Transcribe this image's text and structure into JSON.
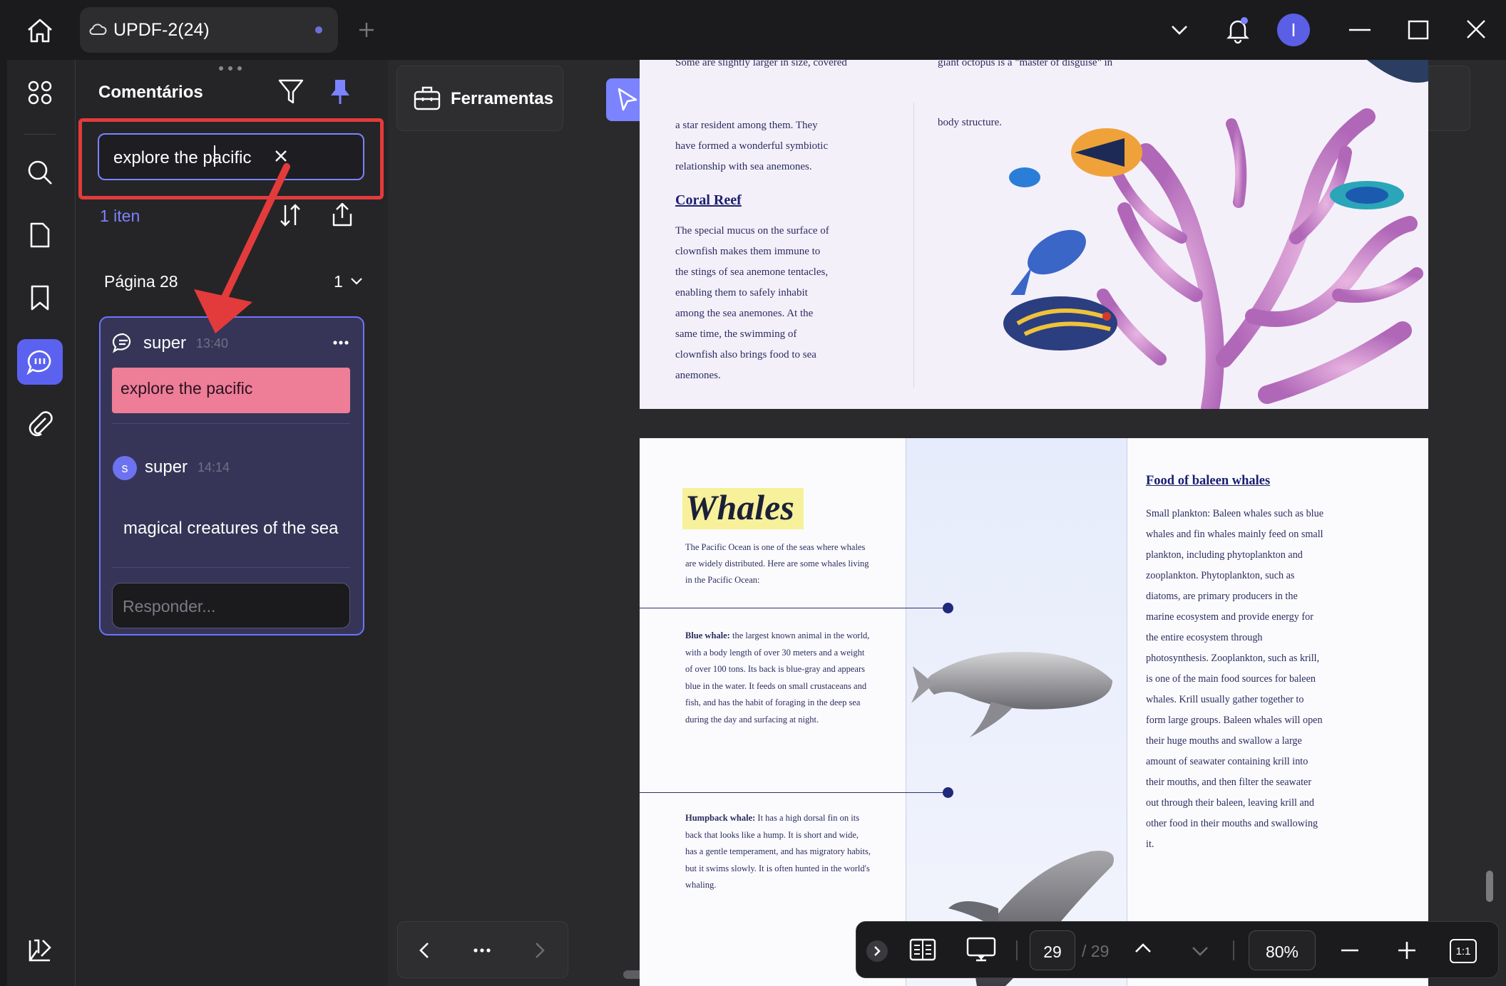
{
  "titlebar": {
    "tab_title": "UPDF-2(24)",
    "avatar_letter": "I"
  },
  "panel": {
    "title": "Comentários",
    "search_value": "explore the pacific",
    "item_count": "1 iten",
    "page_label": "Página 28",
    "page_comment_count": "1",
    "comment": {
      "author": "super",
      "time": "13:40",
      "highlight_text": "explore the pacific",
      "reply": {
        "avatar_letter": "s",
        "author": "super",
        "time": "14:14",
        "text": "magical creatures of the sea"
      },
      "reply_placeholder": "Responder..."
    }
  },
  "toolbar": {
    "tools_label": "Ferramentas"
  },
  "doc": {
    "page1": {
      "top_left_cut": "Some are slightly larger in size, covered",
      "top_right_cut": "giant octopus is a \"master of disguise\" in",
      "p1": "a star resident among them. They have formed a wonderful symbiotic relationship with sea anemones.",
      "right_text": "body structure.",
      "heading": "Coral Reef",
      "p2": "The special mucus on the surface of clownfish makes them immune to the stings of sea anemone tentacles, enabling them to safely inhabit among the sea anemones. At the same time, the swimming of clownfish also brings food to sea anemones."
    },
    "page2": {
      "title": "Whales",
      "intro": "The Pacific Ocean is one of the seas where whales are widely distributed. Here are some whales living in the Pacific Ocean:",
      "blue_label": "Blue whale:",
      "blue_text": " the largest known animal in the world, with a body length of over 30 meters and a weight of over 100 tons. Its back is blue-gray and appears blue in the water. It feeds on small crustaceans and fish, and has the habit of foraging in the deep sea during the day and surfacing at night.",
      "hump_label": "Humpback whale:",
      "hump_text": " It has a high dorsal fin on its back that looks like a hump. It is short and wide, has a gentle temperament, and has migratory habits, but it swims slowly. It is often hunted in the world's whaling.",
      "food_heading": "Food of baleen whales",
      "food_text": "Small plankton: Baleen whales such as blue whales and fin whales mainly feed on small plankton, including phytoplankton and zooplankton. Phytoplankton, such as diatoms, are primary producers in the marine ecosystem and provide energy for the entire ecosystem through photosynthesis. Zooplankton, such as krill, is one of the main food sources for baleen whales. Krill usually gather together to form large groups. Baleen whales will open their huge mouths and swallow a large amount of seawater containing krill into their mouths, and then filter the seawater out through their baleen, leaving krill and other food in their mouths and swallowing it."
    }
  },
  "bottom": {
    "current_page": "29",
    "total_pages": "/ 29",
    "zoom": "80%",
    "fit_label": "1:1"
  },
  "colors": {
    "accent": "#7b83ff",
    "highlight": "#ee7d98",
    "annotation_red": "#e33b3b"
  }
}
